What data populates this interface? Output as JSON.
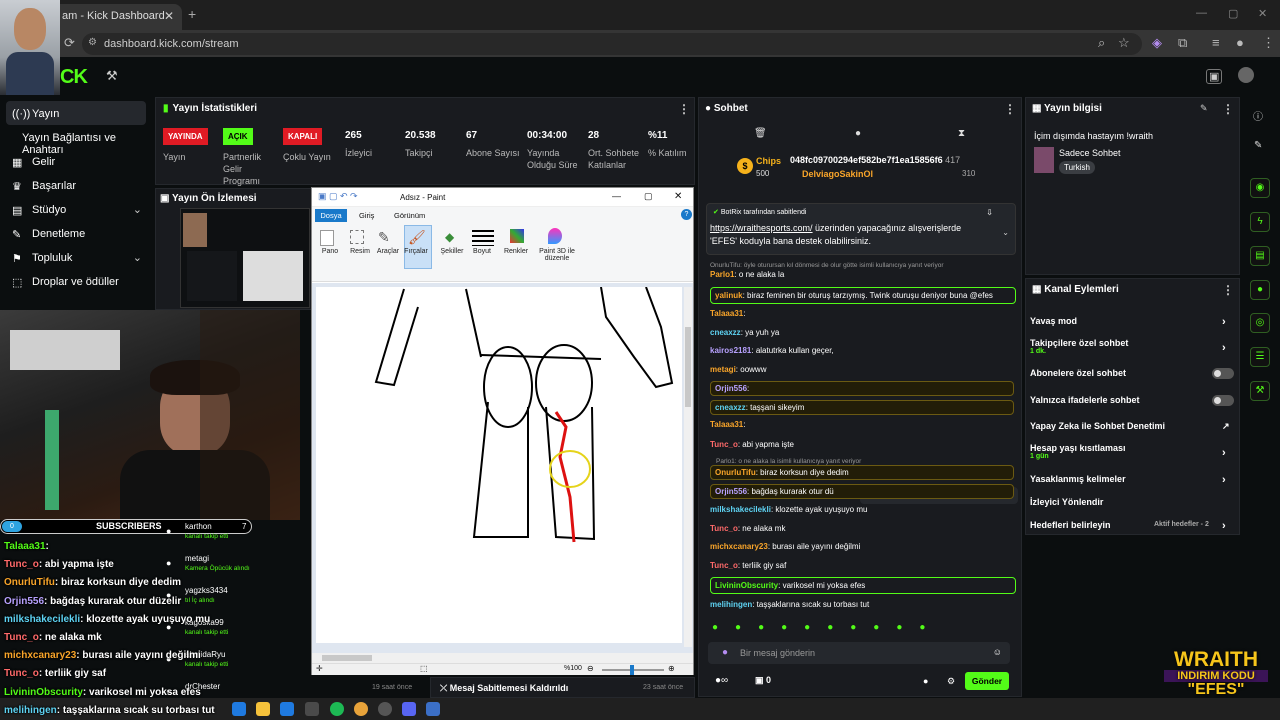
{
  "browser": {
    "tab_title": "am - Kick Dashboard",
    "url": "dashboard.kick.com/stream"
  },
  "nav": {
    "items": [
      {
        "label": "Yayın",
        "icon": "stream-icon"
      },
      {
        "label": "Yayın Bağlantısı ve Anahtarı",
        "icon": ""
      },
      {
        "label": "Gelir",
        "icon": "revenue-icon"
      },
      {
        "label": "Başarılar",
        "icon": "trophy-icon"
      },
      {
        "label": "Stüdyo",
        "icon": "studio-icon"
      },
      {
        "label": "Denetleme",
        "icon": "shield-icon"
      },
      {
        "label": "Topluluk",
        "icon": "people-icon"
      },
      {
        "label": "Droplar ve ödüller",
        "icon": "gift-icon"
      }
    ]
  },
  "stats": {
    "title": "Yayın İstatistikleri",
    "items": [
      {
        "value": "YAYINDA",
        "label": "Yayın",
        "badge": "#e01b24"
      },
      {
        "value": "AÇIK",
        "label": "Partnerlik Gelir Programı",
        "badge": "#53fc18"
      },
      {
        "value": "KAPALI",
        "label": "Çoklu Yayın",
        "badge": "#e01b24"
      },
      {
        "value": "265",
        "label": "İzleyici"
      },
      {
        "value": "20.538",
        "label": "Takipçi"
      },
      {
        "value": "67",
        "label": "Abone Sayısı"
      },
      {
        "value": "00:34:00",
        "label": "Yayında Olduğu Süre"
      },
      {
        "value": "28",
        "label": "Ort. Sohbete Katılanlar"
      },
      {
        "value": "%11",
        "label": "% Katılım"
      }
    ]
  },
  "preview": {
    "title": "Yayın Ön İzlemesi"
  },
  "activity": {
    "items": [
      {
        "user": "karthon",
        "sub": "kanalı takip etti",
        "count": "7"
      },
      {
        "user": "metagi",
        "sub": "Kamera Öpücük alındı"
      },
      {
        "user": "yagzks3434",
        "sub": "tıl İç alındı"
      },
      {
        "user": "kagoska99",
        "sub": "kanalı takip etti"
      },
      {
        "user": "ahmidaRyu",
        "sub": "kanalı takip etti"
      },
      {
        "user": "drChester",
        "sub": ""
      }
    ],
    "footer_time": "19 saat önce",
    "pin_removed": "Mesaj Sabitlemesi Kaldırıldı",
    "pin_time": "23 saat önce"
  },
  "paint": {
    "title": "Adsız - Paint",
    "tabs": [
      "Dosya",
      "Giriş",
      "Görünüm"
    ],
    "tools": [
      "Pano",
      "Resim",
      "Araçlar",
      "Fırçalar",
      "Şekiller",
      "Boyut",
      "Renkler",
      "Paint 3D ile düzenle"
    ],
    "zoom": "%100"
  },
  "chat": {
    "title": "Sohbet",
    "chips_label": "Chips",
    "chips_value": "500",
    "hash": "048fc09700294ef582be7f1ea15856f6",
    "hash_count": "417",
    "user2": "DelviagoSakinOl",
    "user2_count": "310",
    "pinned_by": "BotRix tarafından sabitlendi",
    "pinned_link": "https://wraithesports.com/",
    "pinned_text": " üzerinden yapacağınız alışverişlerde",
    "pinned_text2": "'EFES' koduyla bana destek olabilirsiniz.",
    "reply_note": "OnurluTifu: öyle oturursan kıl dönmesi de olur götte isimli kullanıcıya yanıt veriyor",
    "messages": [
      {
        "user": "Parlo1",
        "color": "#f9a52a",
        "text": ": o ne alaka la"
      },
      {
        "user": "yalinuk",
        "color": "#f9a52a",
        "text": ": biraz feminen bir oturuş tarzıymış. Twink oturuşu deniyor buna @efes",
        "style": "hl"
      },
      {
        "user": "Talaaa31",
        "color": "#f9a52a",
        "text": ":"
      },
      {
        "user": "cneaxzz",
        "color": "#5ed3f3",
        "text": ": ya yuh ya"
      },
      {
        "user": "kairos2181",
        "color": "#b8a2ff",
        "text": ": alatutrka kullan geçer,"
      },
      {
        "user": "metagi",
        "color": "#f9a52a",
        "text": ": oowww"
      },
      {
        "user": "Orjin556",
        "color": "#b8a2ff",
        "text": ":",
        "style": "ylw"
      },
      {
        "user": "cneaxzz",
        "color": "#5ed3f3",
        "text": ": taşşani sikeyim",
        "style": "ylw"
      },
      {
        "user": "Talaaa31",
        "color": "#f9a52a",
        "text": ":"
      },
      {
        "user": "Tunc_o",
        "color": "#ff6a6a",
        "text": ": abi yapma işte"
      },
      {
        "user": "OnurluTifu",
        "color": "#f9a52a",
        "text": ": biraz korksun diye dedim",
        "style": "ylw"
      },
      {
        "user": "Orjin556",
        "color": "#b8a2ff",
        "text": ": bağdaş kurarak otur dü",
        "style": "ylw"
      },
      {
        "user": "milkshakecilekli",
        "color": "#5ed3f3",
        "text": ": klozette ayak uyuşuyo mu"
      },
      {
        "user": "Tunc_o",
        "color": "#ff6a6a",
        "text": ": ne alaka mk"
      },
      {
        "user": "michxcanary23",
        "color": "#f9a52a",
        "text": ": burası aile yayını değilmi"
      },
      {
        "user": "Tunc_o",
        "color": "#ff6a6a",
        "text": ": terliik giy saf"
      },
      {
        "user": "LivininObscurity",
        "color": "#53fc18",
        "text": ": varikosel mi yoksa efes",
        "style": "hl"
      },
      {
        "user": "melihingen",
        "color": "#5ed3f3",
        "text": ": taşşaklarına sıcak su torbası tut"
      }
    ],
    "reply_note2": "Parlo1: o ne alaka la  isimli kullanıcıya yanıt veriyor",
    "input_placeholder": "Bir mesaj gönderin",
    "send": "Gönder",
    "points": "0"
  },
  "info": {
    "title": "Yayın bilgisi",
    "stream_title": "İçim dışımda hastayım !wraith",
    "category": "Sadece Sohbet",
    "lang": "Turkish"
  },
  "actions": {
    "title": "Kanal Eylemleri",
    "items": [
      {
        "label": "Yavaş mod"
      },
      {
        "label": "Takipçilere özel sohbet",
        "sub": "1 dk."
      },
      {
        "label": "Abonelere özel sohbet"
      },
      {
        "label": "Yalnızca ifadelerle sohbet"
      },
      {
        "label": "Yapay Zeka ile Sohbet Denetimi"
      },
      {
        "label": "Hesap yaşı kısıtlaması",
        "sub": "1 gün"
      },
      {
        "label": "Yasaklanmış kelimeler"
      },
      {
        "label": "İzleyici Yönlendir"
      },
      {
        "label": "Hedefleri belirleyin",
        "sub": "Aktif hedefler - 2"
      }
    ]
  },
  "overlay": {
    "subs_label": "SUBSCRIBERS",
    "subs_value": "0",
    "lines": [
      {
        "user": "Talaaa31",
        "color": "#53fc18",
        "text": ":"
      },
      {
        "user": "Tunc_o",
        "color": "#ff6a6a",
        "text": ": abi yapma işte"
      },
      {
        "user": "OnurluTifu",
        "color": "#f9a52a",
        "text": ": biraz korksun diye dedim"
      },
      {
        "user": "Orjin556",
        "color": "#b8a2ff",
        "text": ": bağdaş kurarak otur düzelir"
      },
      {
        "user": "milkshakecilekli",
        "color": "#5ed3f3",
        "text": ": klozette ayak uyuşuyo mu"
      },
      {
        "user": "Tunc_o",
        "color": "#ff6a6a",
        "text": ": ne alaka mk"
      },
      {
        "user": "michxcanary23",
        "color": "#f9a52a",
        "text": ": burası aile yayını değilmi"
      },
      {
        "user": "Tunc_o",
        "color": "#ff6a6a",
        "text": ": terliik giy saf"
      },
      {
        "user": "LivininObscurity",
        "color": "#53fc18",
        "text": ": varikosel mi yoksa efes"
      },
      {
        "user": "melihingen",
        "color": "#5ed3f3",
        "text": ": taşşaklarına sıcak su torbası tut"
      }
    ]
  },
  "promo": {
    "line1": "WRAITH",
    "line2": "INDIRIM KODU",
    "line3": "\"EFES\""
  },
  "colors": {
    "accent": "#53fc18",
    "live": "#e01b24",
    "panel": "#191b1f"
  }
}
